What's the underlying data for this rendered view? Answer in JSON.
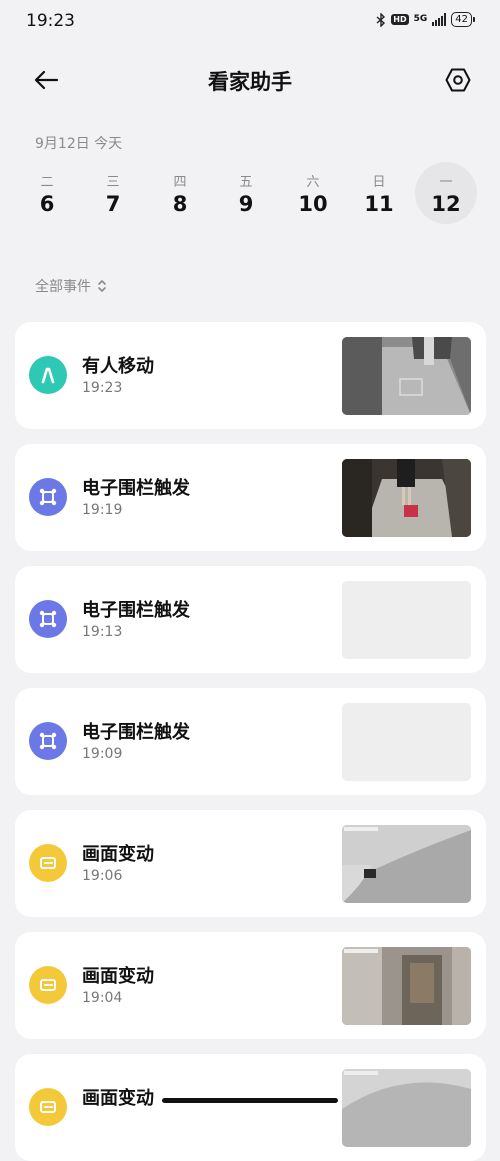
{
  "status_bar": {
    "time": "19:23",
    "hd": "HD",
    "network": "5G",
    "battery": "42"
  },
  "header": {
    "title": "看家助手"
  },
  "date_label": "9月12日 今天",
  "week": [
    {
      "weekday": "二",
      "day": "6",
      "active": false
    },
    {
      "weekday": "三",
      "day": "7",
      "active": false
    },
    {
      "weekday": "四",
      "day": "8",
      "active": false
    },
    {
      "weekday": "五",
      "day": "9",
      "active": false
    },
    {
      "weekday": "六",
      "day": "10",
      "active": false
    },
    {
      "weekday": "日",
      "day": "11",
      "active": false
    },
    {
      "weekday": "一",
      "day": "12",
      "active": true
    }
  ],
  "filter_label": "全部事件",
  "colors": {
    "motion": "#2ec9b4",
    "fence": "#6b78e6",
    "change": "#f3c93a"
  },
  "events": [
    {
      "title": "有人移动",
      "time": "19:23",
      "type": "motion",
      "icon": "person-walking-icon",
      "thumb": "corridor-camera-thumbnail"
    },
    {
      "title": "电子围栏触发",
      "time": "19:19",
      "type": "fence",
      "icon": "fence-frame-icon",
      "thumb": "person-with-suitcase-thumbnail"
    },
    {
      "title": "电子围栏触发",
      "time": "19:13",
      "type": "fence",
      "icon": "fence-frame-icon",
      "thumb": "empty-thumbnail"
    },
    {
      "title": "电子围栏触发",
      "time": "19:09",
      "type": "fence",
      "icon": "fence-frame-icon",
      "thumb": "empty-thumbnail"
    },
    {
      "title": "画面变动",
      "time": "19:06",
      "type": "change",
      "icon": "screen-change-icon",
      "thumb": "wall-camera-thumbnail"
    },
    {
      "title": "画面变动",
      "time": "19:04",
      "type": "change",
      "icon": "screen-change-icon",
      "thumb": "doorway-camera-thumbnail"
    },
    {
      "title": "画面变动",
      "time": "",
      "type": "change",
      "icon": "screen-change-icon",
      "thumb": "ceiling-camera-thumbnail"
    }
  ]
}
